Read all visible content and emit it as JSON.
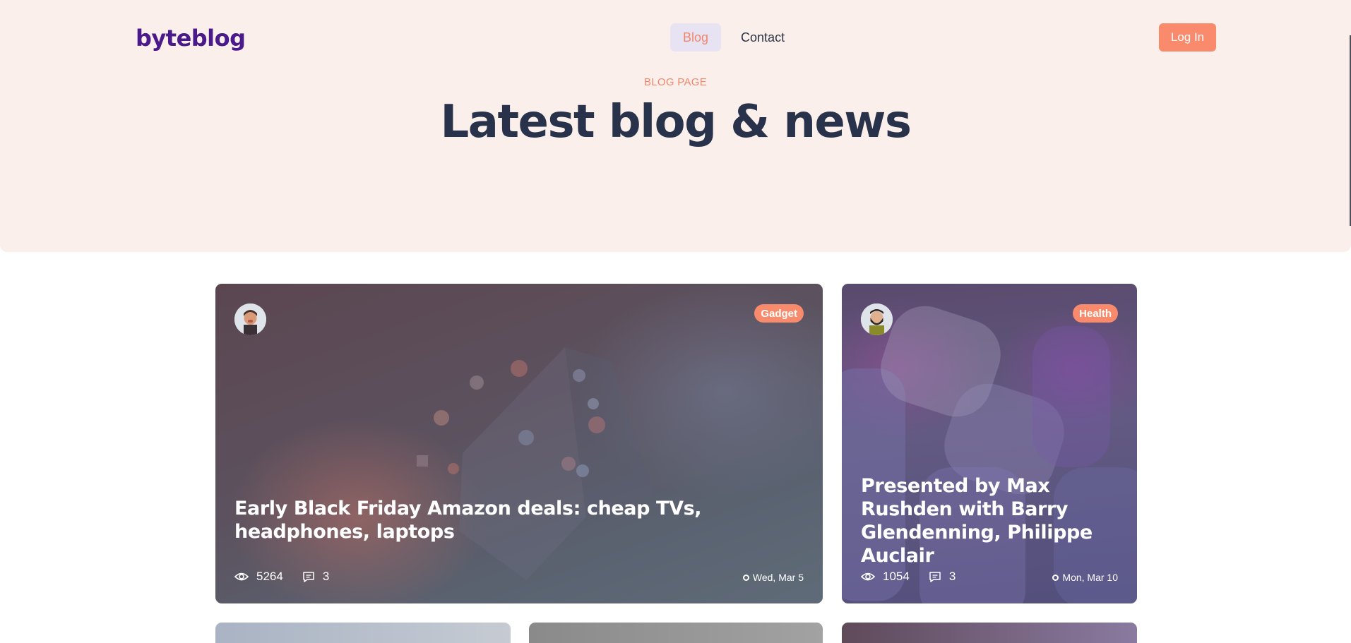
{
  "header": {
    "logo": "byteblog",
    "nav": [
      {
        "label": "Blog",
        "active": true
      },
      {
        "label": "Contact",
        "active": false
      }
    ],
    "login_label": "Log In"
  },
  "hero": {
    "eyebrow": "BLOG PAGE",
    "title": "Latest blog & news"
  },
  "posts": [
    {
      "category": "Gadget",
      "title": "Early Black Friday Amazon deals: cheap TVs, headphones, laptops",
      "views": "5264",
      "comments": "3",
      "date": "Wed, Mar 5"
    },
    {
      "category": "Health",
      "title": "Presented by Max Rushden with Barry Glendenning, Philippe Auclair",
      "views": "1054",
      "comments": "3",
      "date": "Mon, Mar 10"
    }
  ],
  "colors": {
    "brand": "#4a1a8c",
    "accent": "#f98a6c",
    "hero_bg": "#fbefec",
    "heading": "#28324a"
  },
  "icons": [
    "eye-icon",
    "comment-icon",
    "date-dot-icon",
    "author-avatar"
  ]
}
